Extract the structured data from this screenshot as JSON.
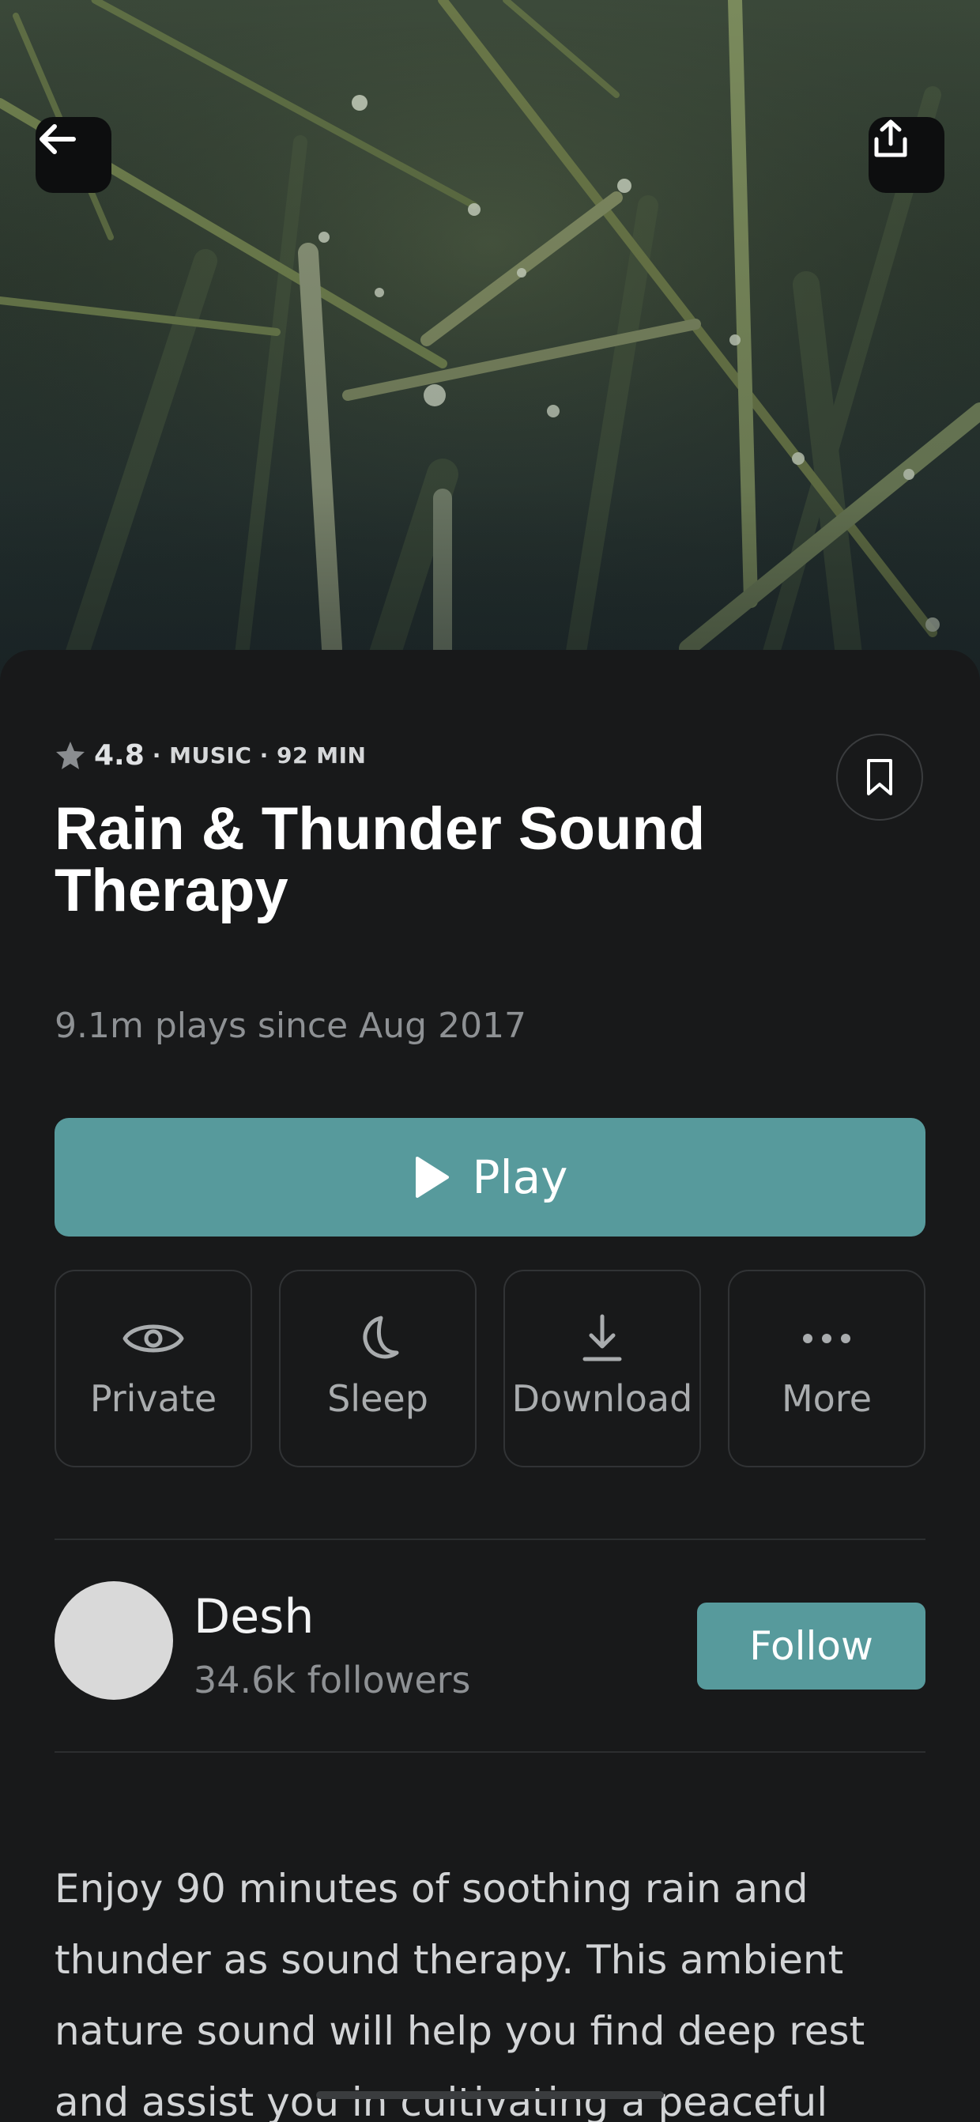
{
  "hero": {
    "back_icon": "arrow-left-icon",
    "share_icon": "share-upload-icon"
  },
  "meta": {
    "star_icon": "star-icon",
    "rating": "4.8",
    "category_line": "· MUSIC · 92 MIN",
    "bookmark_icon": "bookmark-icon"
  },
  "title": {
    "line1": "Rain & Thunder Sound",
    "line2": "Therapy"
  },
  "plays_text": "9.1m plays since Aug 2017",
  "play_button": {
    "label": "Play",
    "icon": "play-icon"
  },
  "actions": [
    {
      "label": "Private",
      "icon": "eye-icon"
    },
    {
      "label": "Sleep",
      "icon": "moon-icon"
    },
    {
      "label": "Download",
      "icon": "download-icon"
    },
    {
      "label": "More",
      "icon": "more-dots-icon"
    }
  ],
  "author": {
    "name": "Desh",
    "followers": "34.6k followers",
    "follow_label": "Follow"
  },
  "description": "Enjoy 90 minutes of soothing rain and thunder as sound therapy. This ambient nature sound will help you find deep rest and assist you in cultivating a peaceful",
  "colors": {
    "accent": "#579a9c",
    "background": "#18191a",
    "title": "#ffffff",
    "muted": "#8e9194"
  }
}
